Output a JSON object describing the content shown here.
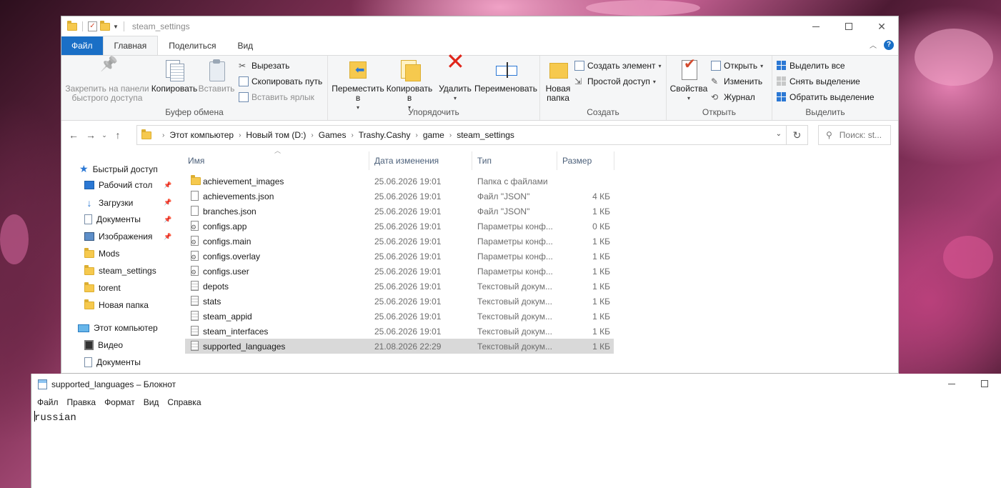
{
  "explorer": {
    "title": "steam_settings",
    "tabs": [
      {
        "label": "Файл"
      },
      {
        "label": "Главная"
      },
      {
        "label": "Поделиться"
      },
      {
        "label": "Вид"
      }
    ],
    "ribbon": {
      "clipboard": {
        "group_label": "Буфер обмена",
        "pin_label": "Закрепить на панели быстрого доступа",
        "copy_label": "Копировать",
        "paste_label": "Вставить",
        "cut_label": "Вырезать",
        "copy_path_label": "Скопировать путь",
        "paste_shortcut_label": "Вставить ярлык"
      },
      "organize": {
        "group_label": "Упорядочить",
        "move_label": "Переместить в",
        "copy_to_label": "Копировать в",
        "delete_label": "Удалить",
        "rename_label": "Переименовать"
      },
      "create": {
        "group_label": "Создать",
        "new_folder_label": "Новая папка",
        "new_item_label": "Создать элемент",
        "easy_access_label": "Простой доступ"
      },
      "open": {
        "group_label": "Открыть",
        "properties_label": "Свойства",
        "open_label": "Открыть",
        "edit_label": "Изменить",
        "history_label": "Журнал"
      },
      "select": {
        "group_label": "Выделить",
        "select_all_label": "Выделить все",
        "select_none_label": "Снять выделение",
        "invert_label": "Обратить выделение"
      }
    },
    "breadcrumb": [
      "Этот компьютер",
      "Новый том (D:)",
      "Games",
      "Trashy.Cashy",
      "game",
      "steam_settings"
    ],
    "search_placeholder": "Поиск: st...",
    "nav": {
      "quick_access": "Быстрый доступ",
      "items": [
        {
          "label": "Рабочий стол",
          "icon": "desktop-icon",
          "pinned": true
        },
        {
          "label": "Загрузки",
          "icon": "download-icon",
          "pinned": true
        },
        {
          "label": "Документы",
          "icon": "documents-icon",
          "pinned": true
        },
        {
          "label": "Изображения",
          "icon": "pictures-icon",
          "pinned": true
        },
        {
          "label": "Mods",
          "icon": "folder-icon",
          "pinned": false
        },
        {
          "label": "steam_settings",
          "icon": "folder-icon",
          "pinned": false
        },
        {
          "label": "torent",
          "icon": "folder-icon",
          "pinned": false
        },
        {
          "label": "Новая папка",
          "icon": "folder-icon",
          "pinned": false
        }
      ],
      "this_pc": "Этот компьютер",
      "pc_items": [
        {
          "label": "Видео",
          "icon": "video-icon"
        },
        {
          "label": "Документы",
          "icon": "documents-icon"
        }
      ]
    },
    "columns": {
      "name": "Имя",
      "date": "Дата изменения",
      "type": "Тип",
      "size": "Размер"
    },
    "files": [
      {
        "name": "achievement_images",
        "date": "25.06.2026 19:01",
        "type": "Папка с файлами",
        "size": "",
        "icon": "folder-icon"
      },
      {
        "name": "achievements.json",
        "date": "25.06.2026 19:01",
        "type": "Файл \"JSON\"",
        "size": "4 КБ",
        "icon": "file-icon"
      },
      {
        "name": "branches.json",
        "date": "25.06.2026 19:01",
        "type": "Файл \"JSON\"",
        "size": "1 КБ",
        "icon": "file-icon"
      },
      {
        "name": "configs.app",
        "date": "25.06.2026 19:01",
        "type": "Параметры конф...",
        "size": "0 КБ",
        "icon": "config-file-icon"
      },
      {
        "name": "configs.main",
        "date": "25.06.2026 19:01",
        "type": "Параметры конф...",
        "size": "1 КБ",
        "icon": "config-file-icon"
      },
      {
        "name": "configs.overlay",
        "date": "25.06.2026 19:01",
        "type": "Параметры конф...",
        "size": "1 КБ",
        "icon": "config-file-icon"
      },
      {
        "name": "configs.user",
        "date": "25.06.2026 19:01",
        "type": "Параметры конф...",
        "size": "1 КБ",
        "icon": "config-file-icon"
      },
      {
        "name": "depots",
        "date": "25.06.2026 19:01",
        "type": "Текстовый докум...",
        "size": "1 КБ",
        "icon": "text-file-icon"
      },
      {
        "name": "stats",
        "date": "25.06.2026 19:01",
        "type": "Текстовый докум...",
        "size": "1 КБ",
        "icon": "text-file-icon"
      },
      {
        "name": "steam_appid",
        "date": "25.06.2026 19:01",
        "type": "Текстовый докум...",
        "size": "1 КБ",
        "icon": "text-file-icon"
      },
      {
        "name": "steam_interfaces",
        "date": "25.06.2026 19:01",
        "type": "Текстовый докум...",
        "size": "1 КБ",
        "icon": "text-file-icon"
      },
      {
        "name": "supported_languages",
        "date": "21.08.2026 22:29",
        "type": "Текстовый докум...",
        "size": "1 КБ",
        "icon": "text-file-icon",
        "selected": true
      }
    ]
  },
  "notepad": {
    "title": "supported_languages – Блокнот",
    "menu": [
      "Файл",
      "Правка",
      "Формат",
      "Вид",
      "Справка"
    ],
    "content": "russian"
  },
  "colors": {
    "file_tab": "#1a6fc6",
    "selection": "#d9d9d9",
    "folder": "#f6c94e"
  }
}
